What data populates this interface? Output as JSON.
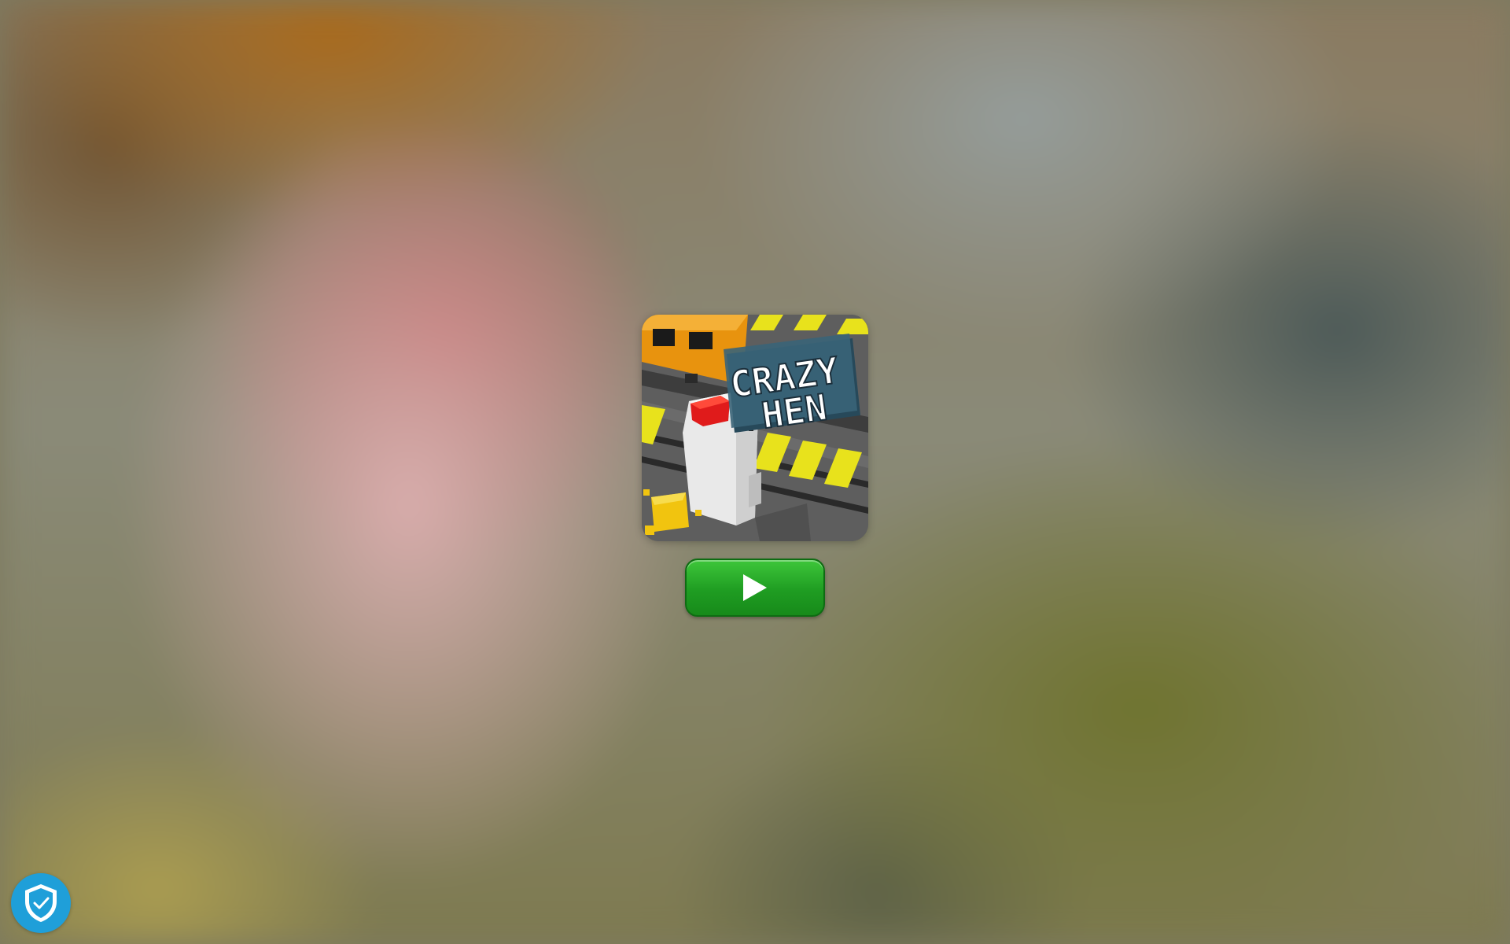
{
  "game": {
    "title_line1": "CRAZY",
    "title_line2": "HEN"
  },
  "icons": {
    "play": "play-icon",
    "shield": "shield-check-icon"
  },
  "colors": {
    "play_button": "#1f9d22",
    "shield_badge": "#1f9fd9"
  }
}
